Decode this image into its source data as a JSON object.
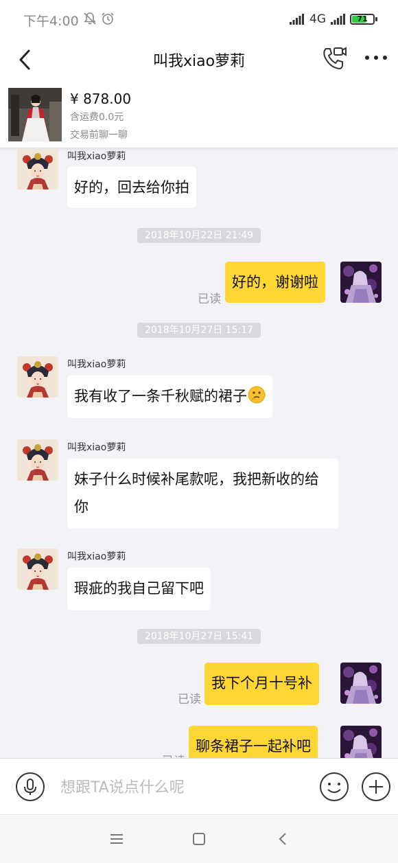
{
  "status_bar": {
    "time": "下午4:00",
    "network": "4G",
    "battery": "71"
  },
  "header": {
    "title": "叫我xiao萝莉"
  },
  "product": {
    "price": "¥ 878.00",
    "shipping": "含运费0.0元",
    "note": "交易前聊一聊"
  },
  "chat": {
    "messages": [
      {
        "sender": "叫我xiao萝莉",
        "text": "好的，回去给你拍"
      },
      {
        "timestamp": "2018年10月22日 21:49"
      },
      {
        "text": "好的，谢谢啦",
        "status": "已读"
      },
      {
        "timestamp": "2018年10月27日 15:17"
      },
      {
        "sender": "叫我xiao萝莉",
        "text": "我有收了一条千秋赋的裙子"
      },
      {
        "sender": "叫我xiao萝莉",
        "text": "妹子什么时候补尾款呢，我把新收的给你"
      },
      {
        "sender": "叫我xiao萝莉",
        "text": "瑕疵的我自己留下吧"
      },
      {
        "timestamp": "2018年10月27日 15:41"
      },
      {
        "text": "我下个月十号补",
        "status": "已读"
      },
      {
        "text": "聊条裙子一起补吧",
        "status": "已读"
      }
    ]
  },
  "input": {
    "placeholder": "想跟TA说点什么呢"
  },
  "colors": {
    "outgoing_bubble": "#ffd633",
    "incoming_bubble": "#ffffff",
    "chat_background": "#f2f2f7"
  }
}
